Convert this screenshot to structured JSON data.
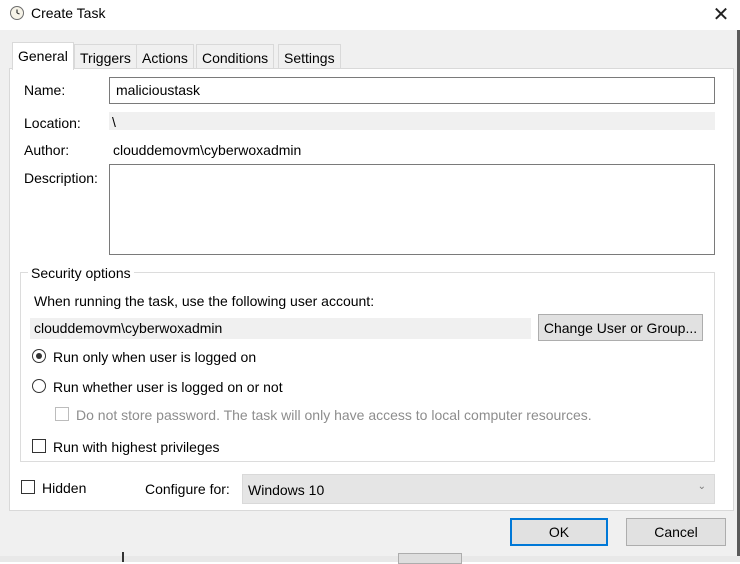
{
  "window": {
    "title": "Create Task",
    "close_glyph": "✕",
    "icon": "task-scheduler-clock-icon"
  },
  "tabs": [
    {
      "label": "General",
      "active": true
    },
    {
      "label": "Triggers",
      "active": false
    },
    {
      "label": "Actions",
      "active": false
    },
    {
      "label": "Conditions",
      "active": false
    },
    {
      "label": "Settings",
      "active": false
    }
  ],
  "general": {
    "name_label": "Name:",
    "name_value": "malicioustask",
    "location_label": "Location:",
    "location_value": "\\",
    "author_label": "Author:",
    "author_value": "clouddemovm\\cyberwoxadmin",
    "description_label": "Description:",
    "description_value": ""
  },
  "security": {
    "group_title": "Security options",
    "account_prompt": "When running the task, use the following user account:",
    "account_value": "clouddemovm\\cyberwoxadmin",
    "change_button": "Change User or Group...",
    "radio_logged_on": {
      "label": "Run only when user is logged on",
      "checked": true
    },
    "radio_whether": {
      "label": "Run whether user is logged on or not",
      "checked": false
    },
    "no_store_password": {
      "label": "Do not store password.  The task will only have access to local computer resources.",
      "checked": false,
      "enabled": false
    },
    "highest_privileges": {
      "label": "Run with highest privileges",
      "checked": false
    }
  },
  "bottom": {
    "hidden_label": "Hidden",
    "hidden_checked": false,
    "configure_label": "Configure for:",
    "configure_value": "Windows 10",
    "dropdown_glyph": "⌄"
  },
  "buttons": {
    "ok": "OK",
    "cancel": "Cancel"
  },
  "colors": {
    "accent": "#0078d7",
    "window_bg": "#f0f0f0",
    "panel_bg": "#ffffff"
  }
}
